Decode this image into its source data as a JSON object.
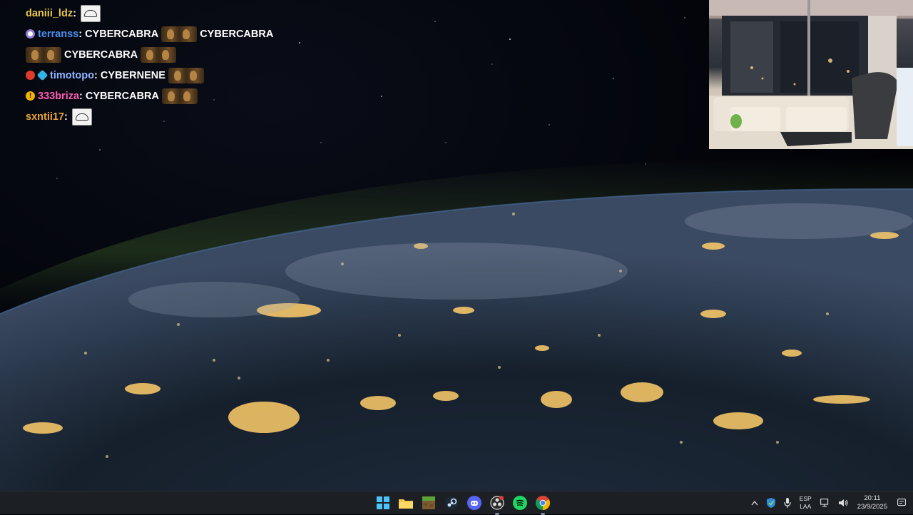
{
  "chat": {
    "lines": [
      {
        "user": "daniii_ldz",
        "user_color": "#e8c84a",
        "message": "",
        "emotes": [
          "sketch-emote"
        ]
      },
      {
        "user": "terranss",
        "user_color": "#4a8ef0",
        "message": "CYBERCABRA",
        "message2": "CYBERCABRA",
        "badges": [
          "purple-badge"
        ]
      },
      {
        "user": "",
        "message": "CYBERCABRA"
      },
      {
        "user": "timotopo",
        "user_color": "#8fb6ff",
        "message": "CYBERNENE",
        "badges": [
          "red-badge",
          "cube-badge"
        ]
      },
      {
        "user": "333briza",
        "user_color": "#ff5db1",
        "message": "CYBERCABRA",
        "badges": [
          "gold-badge"
        ]
      },
      {
        "user": "sxntii17",
        "user_color": "#e8a33a",
        "message": "",
        "emotes": [
          "sketch-emote"
        ]
      }
    ]
  },
  "taskbar": {
    "apps": [
      {
        "name": "windows-start",
        "icon": "windows-logo-icon"
      },
      {
        "name": "file-explorer",
        "icon": "folder-icon"
      },
      {
        "name": "minecraft",
        "icon": "grass-block-icon"
      },
      {
        "name": "steam",
        "icon": "steam-icon"
      },
      {
        "name": "discord",
        "icon": "discord-icon"
      },
      {
        "name": "obs",
        "icon": "obs-icon"
      },
      {
        "name": "spotify",
        "icon": "spotify-icon"
      },
      {
        "name": "chrome",
        "icon": "chrome-icon"
      }
    ],
    "tray": {
      "lang_top": "ESP",
      "lang_bottom": "LAA",
      "time": "20:11",
      "date": "23/9/2025"
    }
  },
  "colors": {
    "taskbar_bg": "#1c1f24",
    "accent": "#4cc2ff"
  }
}
